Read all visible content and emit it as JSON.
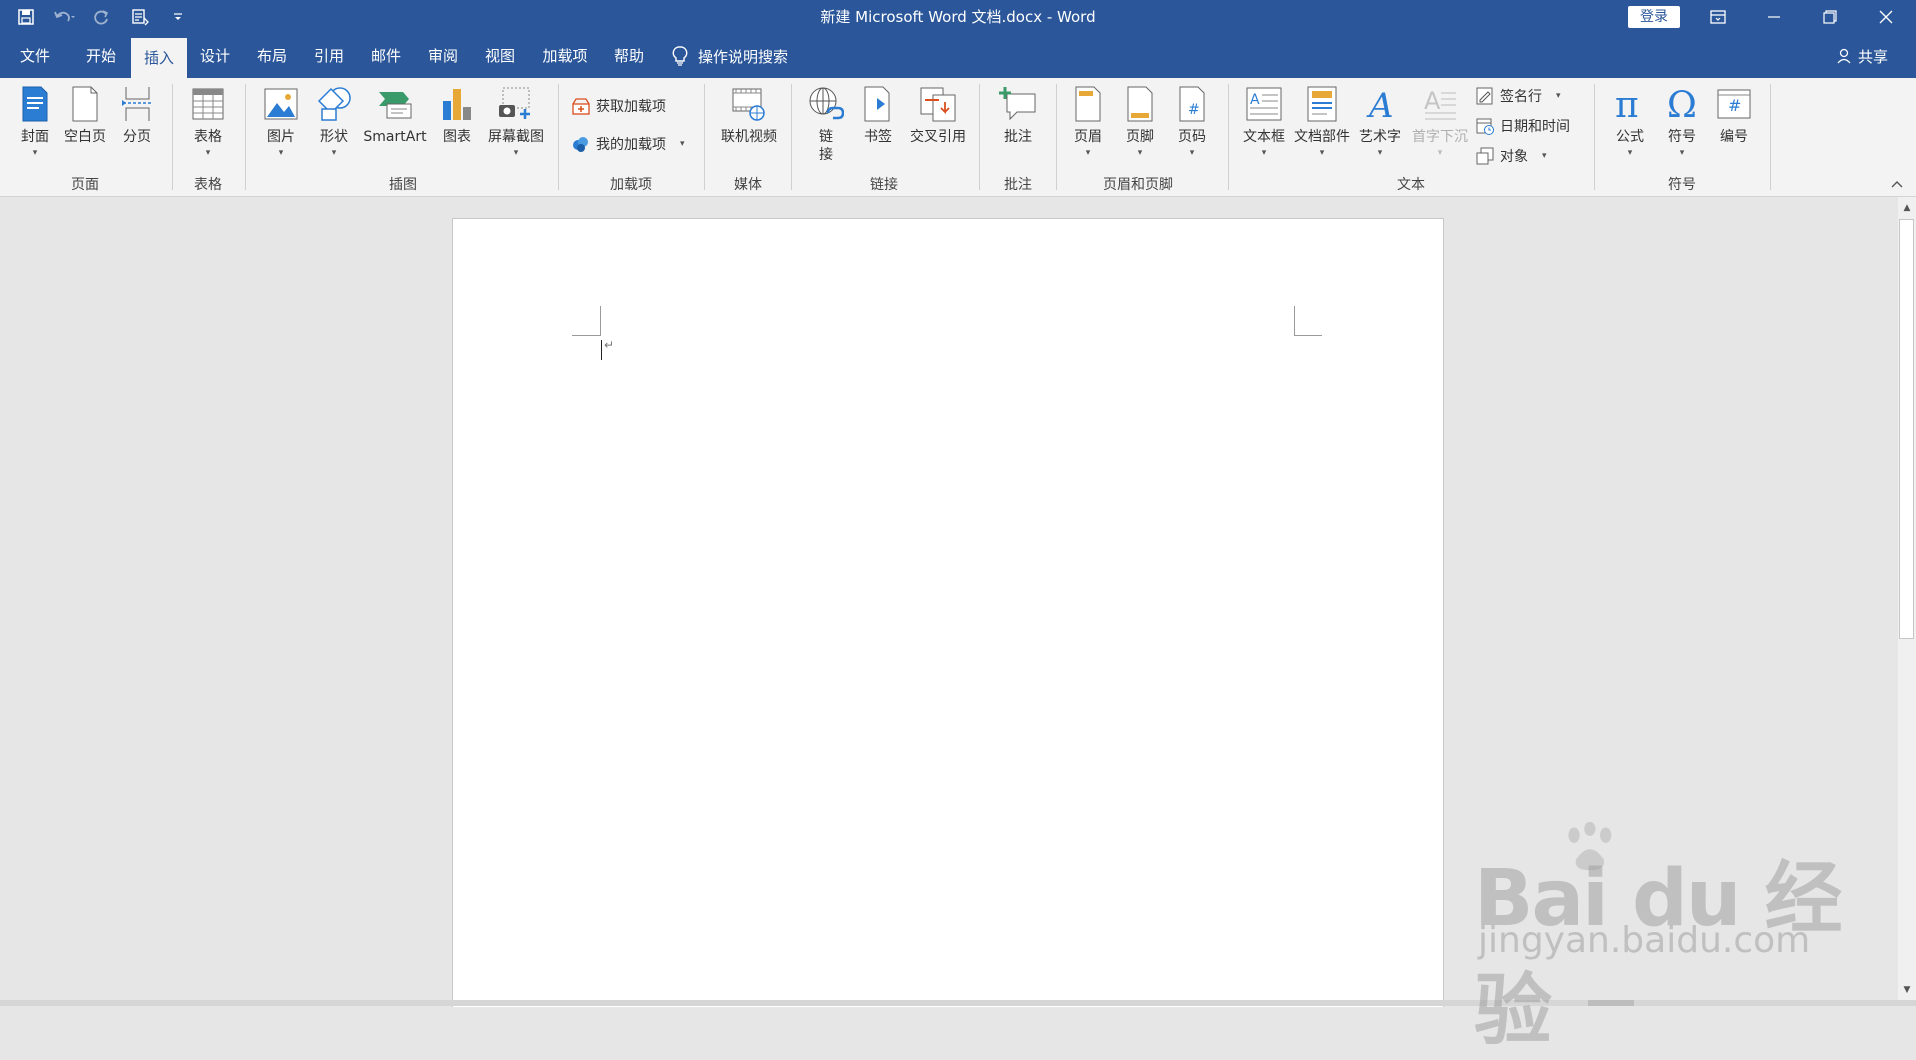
{
  "window": {
    "title": "新建 Microsoft Word 文档.docx  -  Word",
    "login": "登录"
  },
  "qat": {
    "icons": [
      "save-icon",
      "undo-icon",
      "redo-icon",
      "touch-mode-icon",
      "customize-qat-icon"
    ]
  },
  "tabs": [
    {
      "label": "文件"
    },
    {
      "label": "开始"
    },
    {
      "label": "插入"
    },
    {
      "label": "设计"
    },
    {
      "label": "布局"
    },
    {
      "label": "引用"
    },
    {
      "label": "邮件"
    },
    {
      "label": "审阅"
    },
    {
      "label": "视图"
    },
    {
      "label": "加载项"
    },
    {
      "label": "帮助"
    }
  ],
  "active_tab": "插入",
  "tell_me": "操作说明搜索",
  "share": "共享",
  "ribbon": {
    "page": {
      "label": "页面",
      "cover": "封面",
      "blank": "空白页",
      "break": "分页"
    },
    "table": {
      "label": "表格",
      "table": "表格"
    },
    "illustrations": {
      "label": "插图",
      "picture": "图片",
      "shapes": "形状",
      "smartart": "SmartArt",
      "chart": "图表",
      "screenshot": "屏幕截图"
    },
    "addins": {
      "label": "加载项",
      "get": "获取加载项",
      "my": "我的加载项"
    },
    "media": {
      "label": "媒体",
      "video": "联机视频"
    },
    "links": {
      "label": "链接",
      "link": "链接",
      "bookmark": "书签",
      "crossref": "交叉引用"
    },
    "comments": {
      "label": "批注",
      "comment": "批注"
    },
    "header_footer": {
      "label": "页眉和页脚",
      "header": "页眉",
      "footer": "页脚",
      "pagenum": "页码"
    },
    "text": {
      "label": "文本",
      "textbox": "文本框",
      "quickparts": "文档部件",
      "wordart": "艺术字",
      "dropcap": "首字下沉",
      "signature": "签名行",
      "datetime": "日期和时间",
      "object": "对象"
    },
    "symbols": {
      "label": "符号",
      "equation": "公式",
      "symbol": "符号",
      "number": "编号"
    }
  },
  "document": {
    "paragraph_mark": "↵"
  },
  "watermark": {
    "brand": "Bai du 经验",
    "url": "jingyan.baidu.com"
  },
  "colors": {
    "accent": "#2b579a",
    "ribbon_bg": "#f3f3f3",
    "workspace_bg": "#e6e6e6"
  }
}
